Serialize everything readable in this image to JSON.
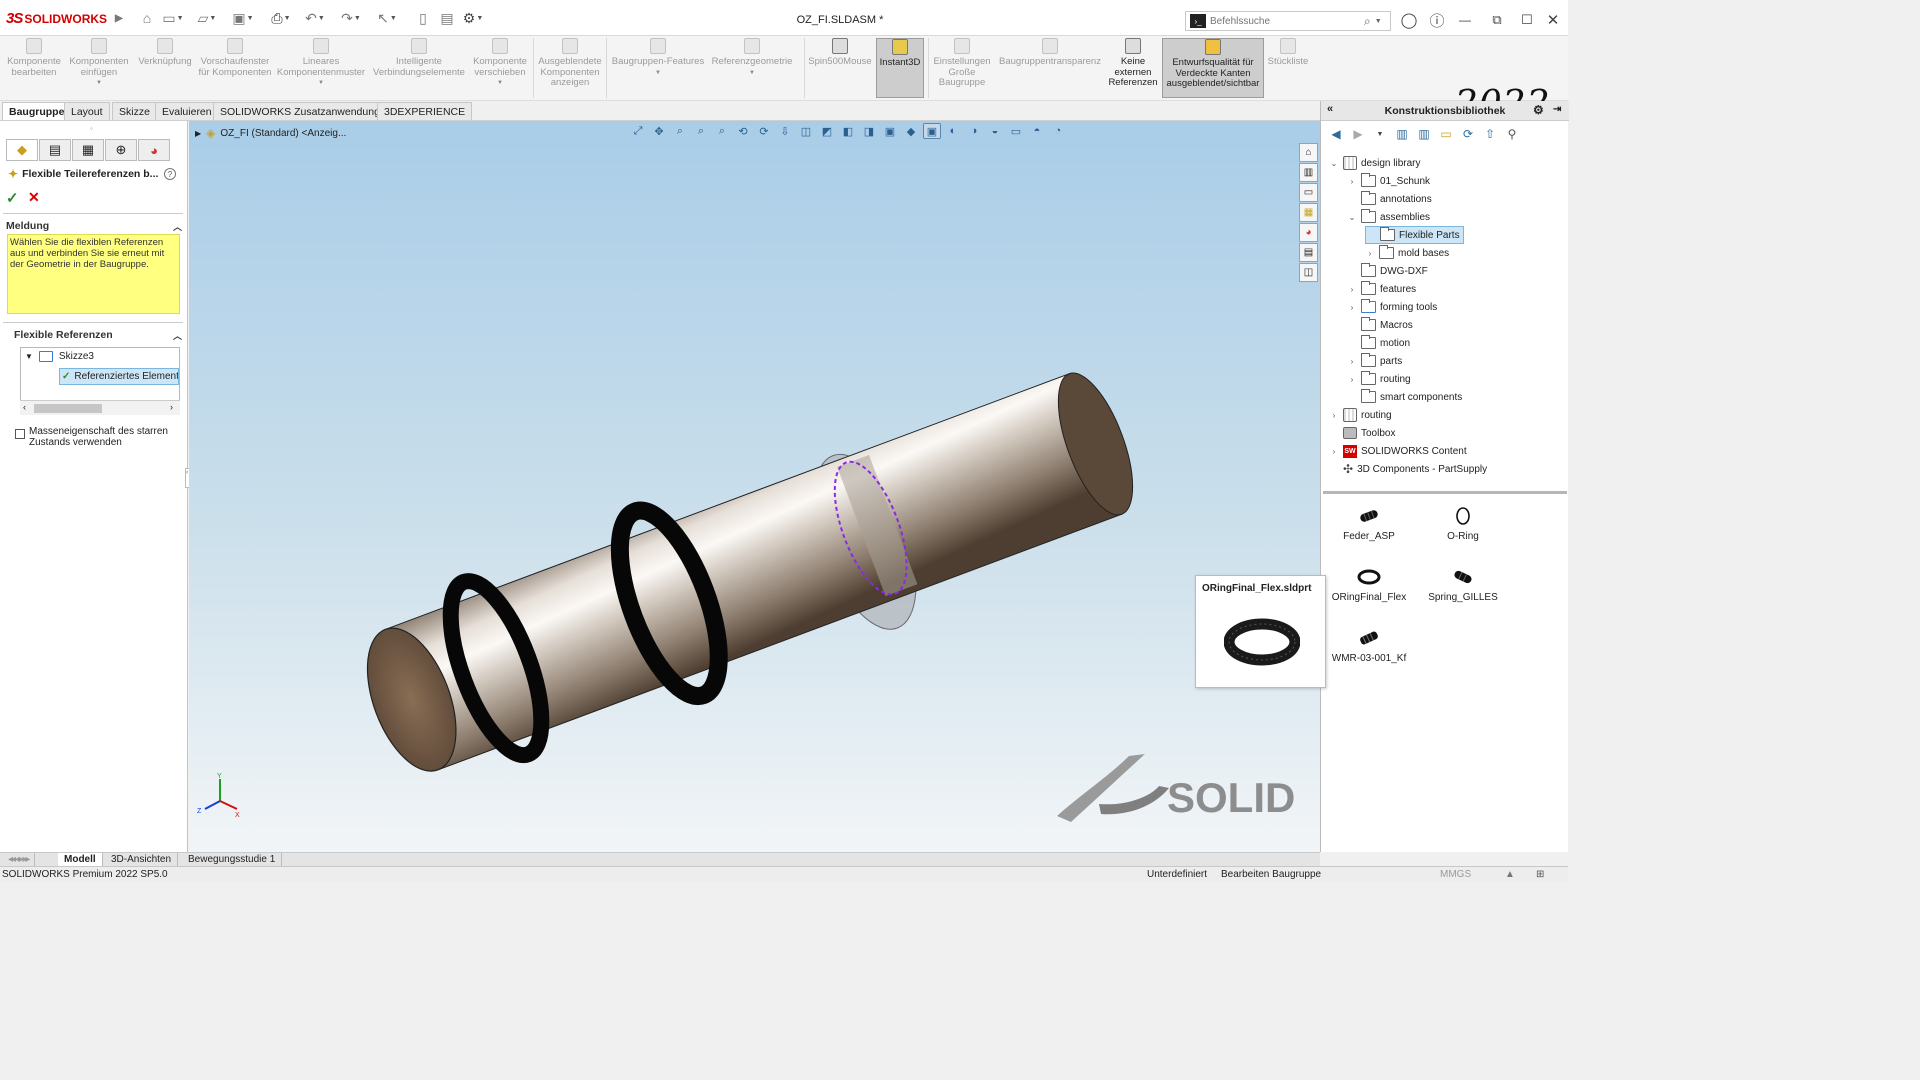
{
  "app": {
    "logo_text": "SOLIDWORKS",
    "document_title": "OZ_FI.SLDASM *",
    "search_placeholder": "Befehlssuche",
    "year_badge": "2022"
  },
  "toolbar": {
    "buttons": [
      {
        "label": "Komponente bearbeiten"
      },
      {
        "label": "Komponenten einfügen"
      },
      {
        "label": "Verknüpfung"
      },
      {
        "label": "Vorschaufenster für Komponenten"
      },
      {
        "label": "Lineares Komponentenmuster"
      },
      {
        "label": "Intelligente Verbindungselemente"
      },
      {
        "label": "Komponente verschieben"
      },
      {
        "label": "Ausgeblendete Komponenten anzeigen"
      },
      {
        "label": "Baugruppen-Features"
      },
      {
        "label": "Referenzgeometrie"
      },
      {
        "label": "Spin500Mouse"
      },
      {
        "label": "Instant3D"
      },
      {
        "label": "Einstellungen Große Baugruppe"
      },
      {
        "label": "Baugruppentransparenz"
      },
      {
        "label": "Keine externen Referenzen"
      },
      {
        "label": "Entwurfsqualität für Verdeckte Kanten ausgeblendet/sichtbar"
      },
      {
        "label": "Stückliste"
      }
    ]
  },
  "tabs": [
    "Baugruppe",
    "Layout",
    "Skizze",
    "Evaluieren",
    "SOLIDWORKS Zusatzanwendungen",
    "3DEXPERIENCE"
  ],
  "property_manager": {
    "title": "Flexible Teilereferenzen b...",
    "message_header": "Meldung",
    "message_text": "Wählen Sie die flexiblen Referenzen aus und verbinden Sie sie erneut mit der Geometrie in der Baugruppe.",
    "flex_header": "Flexible Referenzen",
    "tree": [
      {
        "label": "Skizze3"
      },
      {
        "label": "Referenziertes Element:"
      }
    ],
    "checkbox_label": "Masseneigenschaft des starren Zustands verwenden"
  },
  "viewport": {
    "breadcrumb": "OZ_FI (Standard) <Anzeig...",
    "watermark": "SOLID"
  },
  "design_library": {
    "header": "Konstruktionsbibliothek",
    "tree": [
      {
        "label": "design library",
        "level": 0,
        "expand": "open"
      },
      {
        "label": "01_Schunk",
        "level": 1,
        "expand": "closed"
      },
      {
        "label": "annotations",
        "level": 1,
        "expand": "none"
      },
      {
        "label": "assemblies",
        "level": 1,
        "expand": "open"
      },
      {
        "label": "Flexible Parts",
        "level": 2,
        "expand": "none",
        "selected": true
      },
      {
        "label": "mold bases",
        "level": 2,
        "expand": "closed"
      },
      {
        "label": "DWG-DXF",
        "level": 1,
        "expand": "none"
      },
      {
        "label": "features",
        "level": 1,
        "expand": "closed"
      },
      {
        "label": "forming tools",
        "level": 1,
        "expand": "closed"
      },
      {
        "label": "Macros",
        "level": 1,
        "expand": "none"
      },
      {
        "label": "motion",
        "level": 1,
        "expand": "none"
      },
      {
        "label": "parts",
        "level": 1,
        "expand": "closed"
      },
      {
        "label": "routing",
        "level": 1,
        "expand": "closed"
      },
      {
        "label": "smart components",
        "level": 1,
        "expand": "none"
      },
      {
        "label": "routing",
        "level": 0,
        "expand": "closed"
      },
      {
        "label": "Toolbox",
        "level": 0,
        "expand": "none"
      },
      {
        "label": "SOLIDWORKS Content",
        "level": 0,
        "expand": "closed"
      },
      {
        "label": "3D Components - PartSupply",
        "level": 0,
        "expand": "none"
      }
    ],
    "thumbnails": [
      {
        "label": "Feder_ASP",
        "icon": "spring-icon"
      },
      {
        "label": "O-Ring",
        "icon": "oring-icon"
      },
      {
        "label": "ORingFinal_Flex",
        "icon": "oring-icon"
      },
      {
        "label": "Spring_GILLES",
        "icon": "spring-icon"
      },
      {
        "label": "WMR-03-001_Kf",
        "icon": "spring-icon"
      }
    ],
    "tooltip_title": "ORingFinal_Flex.sldprt"
  },
  "bottom_tabs": [
    "Modell",
    "3D-Ansichten",
    "Bewegungsstudie 1"
  ],
  "status": {
    "version": "SOLIDWORKS Premium 2022 SP5.0",
    "state": "Unterdefiniert",
    "mode": "Bearbeiten Baugruppe",
    "units": "MMGS"
  },
  "colors": {
    "brand": "#d40000",
    "message_bg": "#ffff80",
    "selected_bg": "#cde6f7"
  }
}
